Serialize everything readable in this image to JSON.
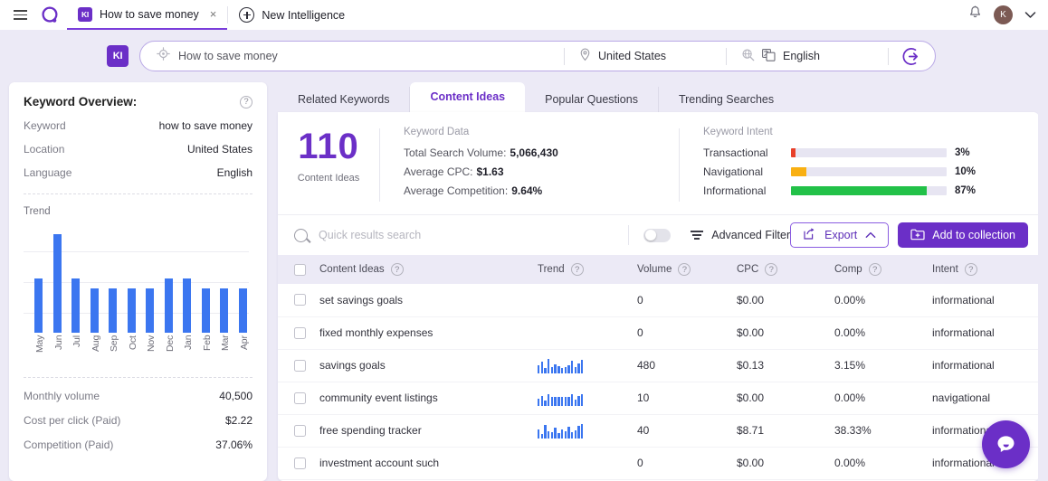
{
  "topbar": {
    "menu_icon": "hamburger-icon",
    "logo_icon": "brand-logo-icon",
    "tabs": [
      {
        "badge": "KI",
        "label": "How to save money",
        "close": "×",
        "active": true
      },
      {
        "badge": "",
        "label": "New Intelligence",
        "close": "",
        "active": false
      }
    ],
    "notification_icon": "bell-icon",
    "avatar_initial": "K",
    "chevron": "⌄"
  },
  "search": {
    "badge": "KI",
    "query": "How to save money",
    "placeholder": "How to save money",
    "location": "United States",
    "language": "English",
    "target_icon": "target-icon",
    "pin_icon": "location-pin-icon",
    "globe_icon": "globe-icon",
    "lang_icon": "translate-icon",
    "go_icon": "enter-arrow-icon"
  },
  "overview": {
    "title": "Keyword Overview:",
    "help_icon": "help-circle-icon",
    "rows": [
      {
        "label": "Keyword",
        "value": "how to save money"
      },
      {
        "label": "Location",
        "value": "United States"
      },
      {
        "label": "Language",
        "value": "English"
      }
    ],
    "trend_label": "Trend",
    "stats": [
      {
        "label": "Monthly volume",
        "value": "40,500"
      },
      {
        "label": "Cost per click (Paid)",
        "value": "$2.22"
      },
      {
        "label": "Competition (Paid)",
        "value": "37.06%"
      }
    ]
  },
  "chart_data": {
    "type": "bar",
    "title": "Trend",
    "categories": [
      "May",
      "Jun",
      "Jul",
      "Aug",
      "Sep",
      "Oct",
      "Nov",
      "Dec",
      "Jan",
      "Feb",
      "Mar",
      "Apr"
    ],
    "values": [
      40500,
      74000,
      40500,
      33100,
      33100,
      33100,
      33100,
      40500,
      40500,
      33100,
      33100,
      33100
    ],
    "xlabel": "",
    "ylabel": "",
    "ylim": [
      0,
      80000
    ],
    "grid": true,
    "legend": "none",
    "color": "#3b76f0"
  },
  "panel_tabs": [
    {
      "label": "Related Keywords",
      "active": false
    },
    {
      "label": "Content Ideas",
      "active": true
    },
    {
      "label": "Popular Questions",
      "active": false
    },
    {
      "label": "Trending Searches",
      "active": false
    }
  ],
  "summary": {
    "count": "110",
    "count_label": "Content Ideas",
    "keyword_data_title": "Keyword Data",
    "keyword_data": [
      {
        "label": "Total Search Volume:",
        "value": "5,066,430"
      },
      {
        "label": "Average CPC:",
        "value": "$1.63"
      },
      {
        "label": "Average Competition:",
        "value": "9.64%"
      }
    ],
    "intent_title": "Keyword Intent",
    "intent": [
      {
        "name": "Transactional",
        "pct": "3%",
        "value": 3,
        "color": "#e8402a"
      },
      {
        "name": "Navigational",
        "pct": "10%",
        "value": 10,
        "color": "#f9b012"
      },
      {
        "name": "Informational",
        "pct": "87%",
        "value": 87,
        "color": "#22c148"
      }
    ]
  },
  "toolbar": {
    "search_placeholder": "Quick results search",
    "search_icon": "search-icon",
    "toggle_state": "off",
    "filter_icon": "filter-icon",
    "advanced_filter": "Advanced Filter",
    "export_label": "Export",
    "export_icon": "export-icon",
    "export_chevron": "chevron-up-icon",
    "add_collection_label": "Add to collection",
    "add_collection_icon": "folder-plus-icon"
  },
  "table": {
    "columns": [
      {
        "key": "name",
        "label": "Content Ideas",
        "help": true
      },
      {
        "key": "trend",
        "label": "Trend",
        "help": true
      },
      {
        "key": "volume",
        "label": "Volume",
        "help": true
      },
      {
        "key": "cpc",
        "label": "CPC",
        "help": true
      },
      {
        "key": "comp",
        "label": "Comp",
        "help": true
      },
      {
        "key": "intent",
        "label": "Intent",
        "help": true
      }
    ],
    "rows": [
      {
        "name": "set savings goals",
        "trend": [],
        "volume": "0",
        "cpc": "$0.00",
        "comp": "0.00%",
        "intent": "informational"
      },
      {
        "name": "fixed monthly expenses",
        "trend": [],
        "volume": "0",
        "cpc": "$0.00",
        "comp": "0.00%",
        "intent": "informational"
      },
      {
        "name": "savings goals",
        "trend": [
          9,
          13,
          6,
          16,
          7,
          10,
          8,
          6,
          7,
          9,
          14,
          7,
          11,
          15
        ],
        "volume": "480",
        "cpc": "$0.13",
        "comp": "3.15%",
        "intent": "informational"
      },
      {
        "name": "community event listings",
        "trend": [
          8,
          11,
          6,
          13,
          10,
          10,
          10,
          10,
          10,
          10,
          13,
          7,
          11,
          13
        ],
        "volume": "10",
        "cpc": "$0.00",
        "comp": "0.00%",
        "intent": "navigational"
      },
      {
        "name": "free spending tracker",
        "trend": [
          10,
          5,
          15,
          8,
          7,
          12,
          6,
          10,
          8,
          13,
          7,
          9,
          14,
          16
        ],
        "volume": "40",
        "cpc": "$8.71",
        "comp": "38.33%",
        "intent": "informational"
      },
      {
        "name": "investment account such",
        "trend": [],
        "volume": "0",
        "cpc": "$0.00",
        "comp": "0.00%",
        "intent": "informational"
      }
    ]
  },
  "chat": {
    "icon": "chat-bubble-icon"
  }
}
